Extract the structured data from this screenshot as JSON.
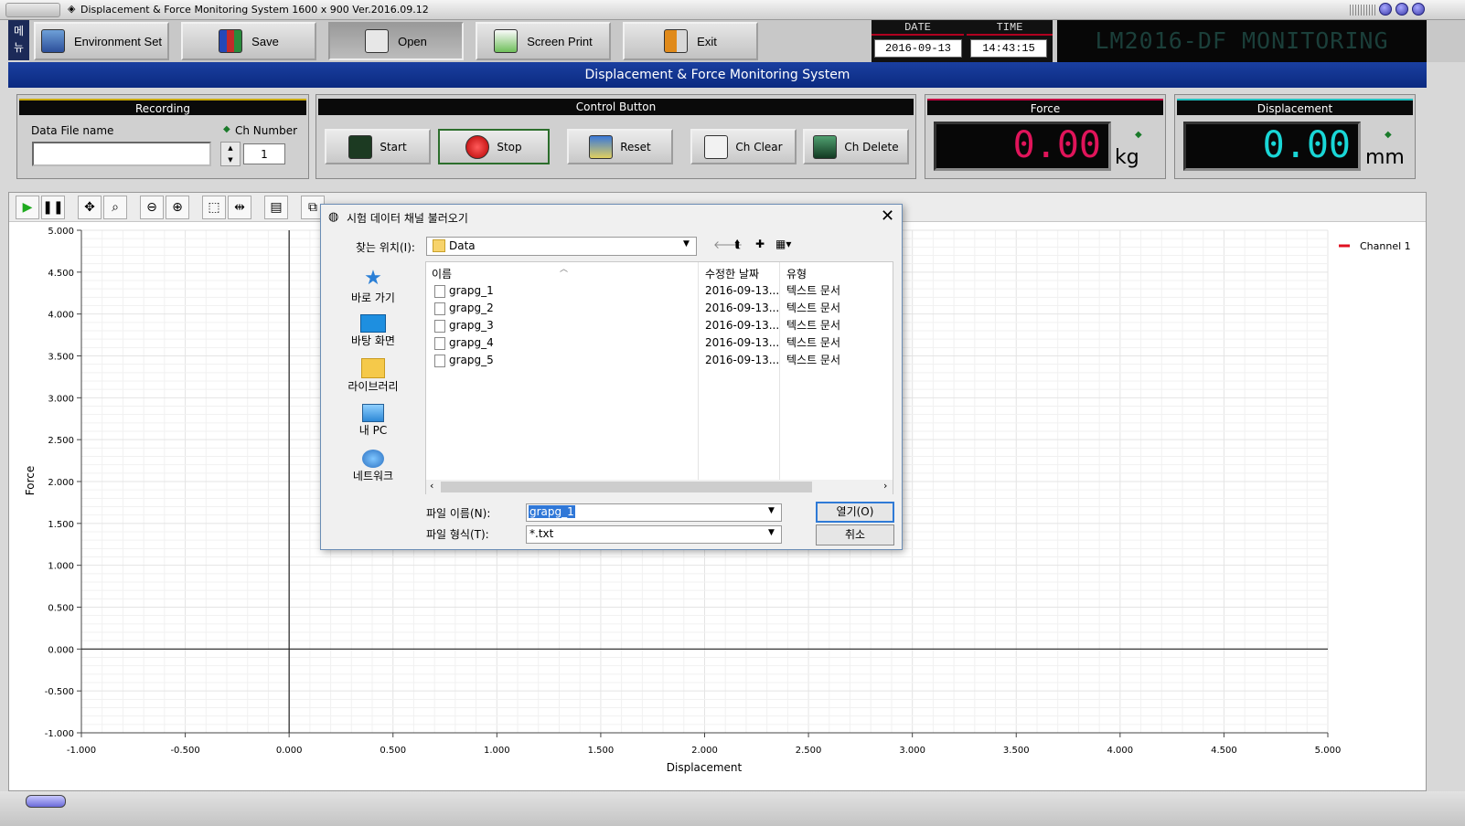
{
  "window": {
    "title": "Displacement  & Force Monitoring System 1600 x 900  Ver.2016.09.12"
  },
  "menu_tab": {
    "label_top": "메",
    "label_bottom": "뉴"
  },
  "toolbar": {
    "buttons": [
      {
        "label": "Environment Set",
        "icon": "settings-monitor-icon"
      },
      {
        "label": "Save",
        "icon": "floppy-disks-icon"
      },
      {
        "label": "Open",
        "icon": "open-folder-icon"
      },
      {
        "label": "Screen Print",
        "icon": "printer-icon"
      },
      {
        "label": "Exit",
        "icon": "exit-door-icon"
      }
    ]
  },
  "datetime": {
    "date_label": "DATE",
    "date_value": "2016-09-13",
    "time_label": "TIME",
    "time_value": "14:43:15"
  },
  "brand": {
    "text": "LM2016-DF MONITORING"
  },
  "subheader": {
    "title": "Displacement   &   Force  Monitoring  System"
  },
  "recording": {
    "title": "Recording",
    "file_label": "Data File name",
    "file_value": "",
    "ch_label": "Ch Number",
    "ch_value": "1"
  },
  "control": {
    "title": "Control Button",
    "buttons": [
      {
        "label": "Start",
        "icon": "chart-monitor-icon"
      },
      {
        "label": "Stop",
        "icon": "stop-icon"
      },
      {
        "label": "Reset",
        "icon": "reset-arrows-icon"
      },
      {
        "label": "Ch Clear",
        "icon": "eraser-icon"
      },
      {
        "label": "Ch Delete",
        "icon": "trash-icon"
      }
    ]
  },
  "force": {
    "title": "Force",
    "value": "0.00",
    "unit": "kg",
    "color": "#e0145a"
  },
  "displacement": {
    "title": "Displacement",
    "value": "0.00",
    "unit": "mm",
    "color": "#19d6d6"
  },
  "chart_data": {
    "type": "line",
    "xlabel": "Displacement",
    "ylabel": "Force",
    "xlim": [
      -1.0,
      5.0
    ],
    "ylim": [
      -1.0,
      5.0
    ],
    "x_ticks": [
      "-1.000",
      "-0.500",
      "0.000",
      "0.500",
      "1.000",
      "1.500",
      "2.000",
      "2.500",
      "3.000",
      "3.500",
      "4.000",
      "4.500",
      "5.000"
    ],
    "y_ticks": [
      "5.000",
      "4.500",
      "4.000",
      "3.500",
      "3.000",
      "2.500",
      "2.000",
      "1.500",
      "1.000",
      "0.500",
      "0.000",
      "-0.500",
      "-1.000"
    ],
    "grid": true,
    "legend_position": "top-right",
    "series": [
      {
        "name": "Channel 1",
        "color": "#e01020",
        "x": [],
        "y": []
      }
    ]
  },
  "dialog": {
    "title": "시험 데이터 채널 불러오기",
    "location_label": "찾는 위치(I):",
    "location_value": "Data",
    "quick_access": [
      {
        "label": "바로 가기",
        "icon": "star-icon"
      },
      {
        "label": "바탕 화면",
        "icon": "desktop-icon"
      },
      {
        "label": "라이브러리",
        "icon": "library-folder-icon"
      },
      {
        "label": "내 PC",
        "icon": "computer-icon"
      },
      {
        "label": "네트워크",
        "icon": "network-icon"
      }
    ],
    "columns": [
      "이름",
      "수정한 날짜",
      "유형"
    ],
    "files": [
      {
        "name": "grapg_1",
        "date": "2016-09-13...",
        "type": "텍스트 문서"
      },
      {
        "name": "grapg_2",
        "date": "2016-09-13...",
        "type": "텍스트 문서"
      },
      {
        "name": "grapg_3",
        "date": "2016-09-13...",
        "type": "텍스트 문서"
      },
      {
        "name": "grapg_4",
        "date": "2016-09-13...",
        "type": "텍스트 문서"
      },
      {
        "name": "grapg_5",
        "date": "2016-09-13...",
        "type": "텍스트 문서"
      }
    ],
    "filename_label": "파일 이름(N):",
    "filename_value": "grapg_1",
    "filetype_label": "파일 형식(T):",
    "filetype_value": "*.txt",
    "open_label": "열기(O)",
    "cancel_label": "취소"
  }
}
